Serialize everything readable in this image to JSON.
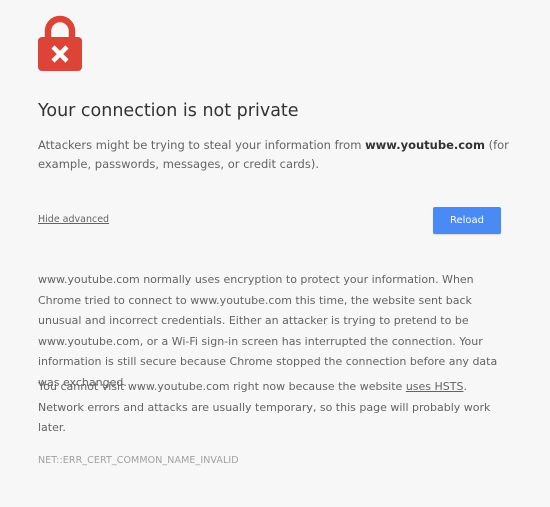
{
  "icon": "lock-error-icon",
  "colors": {
    "lock": "#db4437",
    "accent": "#4a8af4",
    "background": "#f7f7f7"
  },
  "heading": "Your connection is not private",
  "explanation": {
    "before": "Attackers might be trying to steal your information from ",
    "domain": "www.youtube.com",
    "after": " (for example, passwords, messages, or credit cards)."
  },
  "hide_advanced": "Hide advanced",
  "reload_button": "Reload",
  "details": "www.youtube.com normally uses encryption to protect your information. When Chrome tried to connect to www.youtube.com this time, the website sent back unusual and incorrect credentials. Either an attacker is trying to pretend to be www.youtube.com, or a Wi-Fi sign-in screen has interrupted the connection. Your information is still secure because Chrome stopped the connection before any data was exchanged.",
  "hsts": {
    "before": "You cannot visit www.youtube.com right now because the website ",
    "link": "uses HSTS",
    "after": ". Network errors and attacks are usually temporary, so this page will probably work later."
  },
  "error_code": "NET::ERR_CERT_COMMON_NAME_INVALID"
}
